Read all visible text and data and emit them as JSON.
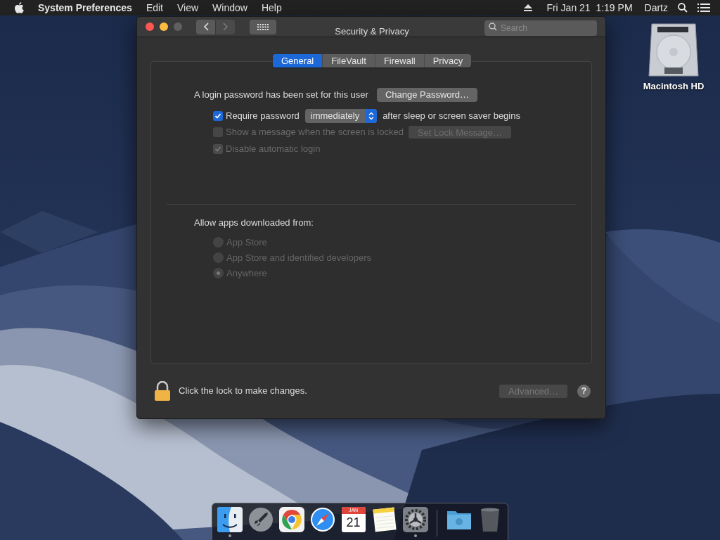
{
  "menu_bar": {
    "app_name": "System Preferences",
    "menus": [
      "Edit",
      "View",
      "Window",
      "Help"
    ],
    "clock": "Fri Jan 21  1:19 PM",
    "user": "Dartz"
  },
  "desktop_icons": [
    {
      "label": "Macintosh HD"
    }
  ],
  "window": {
    "title": "Security & Privacy",
    "search": {
      "placeholder": "Search"
    },
    "tabs": [
      {
        "label": "General",
        "selected": true
      },
      {
        "label": "FileVault",
        "selected": false
      },
      {
        "label": "Firewall",
        "selected": false
      },
      {
        "label": "Privacy",
        "selected": false
      }
    ],
    "general": {
      "password_text": "A login password has been set for this user",
      "change_password_button": "Change Password…",
      "options": [
        {
          "kind": "checkbox-select",
          "label": "Require password",
          "checked": true,
          "disabled": false,
          "select_value": "immediately",
          "suffix": "after sleep or screen saver begins"
        },
        {
          "kind": "checkbox-button",
          "label": "Show a message when the screen is locked",
          "checked": false,
          "disabled": true,
          "button": "Set Lock Message…"
        },
        {
          "kind": "checkbox",
          "label": "Disable automatic login",
          "checked": true,
          "disabled": true
        }
      ],
      "allow_heading": "Allow apps downloaded from:",
      "allow_options": [
        {
          "label": "App Store",
          "selected": false,
          "disabled": true
        },
        {
          "label": "App Store and identified developers",
          "selected": false,
          "disabled": true
        },
        {
          "label": "Anywhere",
          "selected": true,
          "disabled": true
        }
      ]
    },
    "footer": {
      "lock_text": "Click the lock to make changes.",
      "advanced_button": {
        "label": "Advanced…",
        "disabled": true
      },
      "help_button": "?"
    }
  },
  "dock": {
    "items": [
      {
        "kind": "finder",
        "running": true
      },
      {
        "kind": "rocket",
        "running": false
      },
      {
        "kind": "browser",
        "running": false
      },
      {
        "kind": "compass",
        "running": false
      },
      {
        "kind": "calendar",
        "running": false,
        "month": "JAN",
        "day": "21"
      },
      {
        "kind": "notes",
        "running": false
      },
      {
        "kind": "gear",
        "running": true
      },
      {
        "kind": "separator"
      },
      {
        "kind": "folder",
        "running": false
      },
      {
        "kind": "trash",
        "running": false
      }
    ]
  }
}
